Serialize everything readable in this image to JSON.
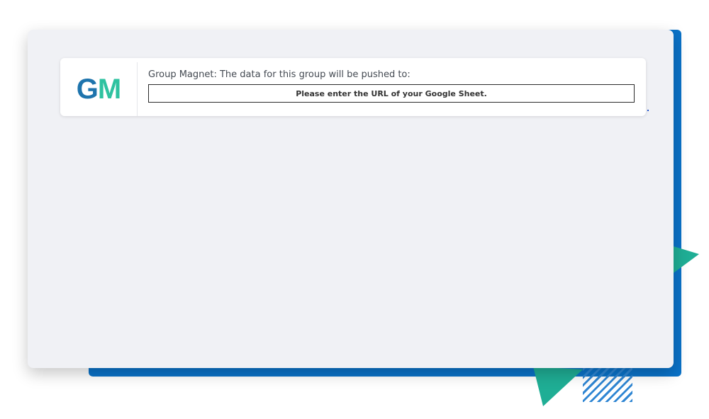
{
  "logo": {
    "letter_g": "G",
    "letter_m": "M",
    "color_g": "#1e74ad",
    "color_m": "#2fc2a0"
  },
  "card": {
    "label": "Group Magnet: The data for this group will be pushed to:",
    "url_field": {
      "value": "Please enter the URL of your Google Sheet."
    }
  },
  "colors": {
    "backdrop_blue": "#0a72c8",
    "accent_teal": "#1fae95",
    "window_bg": "#f0f1f5"
  }
}
